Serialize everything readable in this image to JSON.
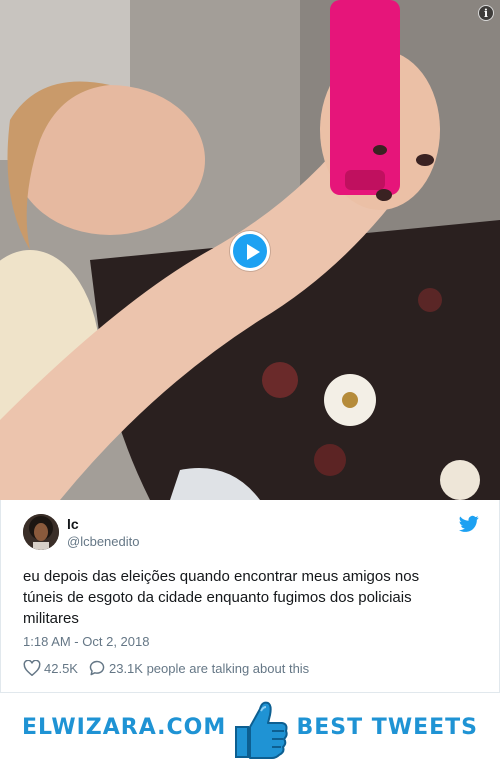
{
  "media": {
    "type": "video",
    "info_icon": "info-icon",
    "play_icon": "play-icon"
  },
  "tweet": {
    "display_name": "lc",
    "handle": "@lcbenedito",
    "text": "eu depois das eleições quando encontrar meus amigos nos túneis de esgoto da cidade enquanto fugimos dos policiais militares",
    "timestamp": "1:18 AM - Oct 2, 2018",
    "likes": "42.5K",
    "talking": "23.1K people are talking about this",
    "brand_icon": "twitter-bird-icon",
    "accent_color": "#1da1f2"
  },
  "banner": {
    "left_text": "ELWIZARA.COM",
    "right_text": "BEST TWEETS",
    "icon": "thumbs-up-icon",
    "color": "#1f93d4"
  }
}
